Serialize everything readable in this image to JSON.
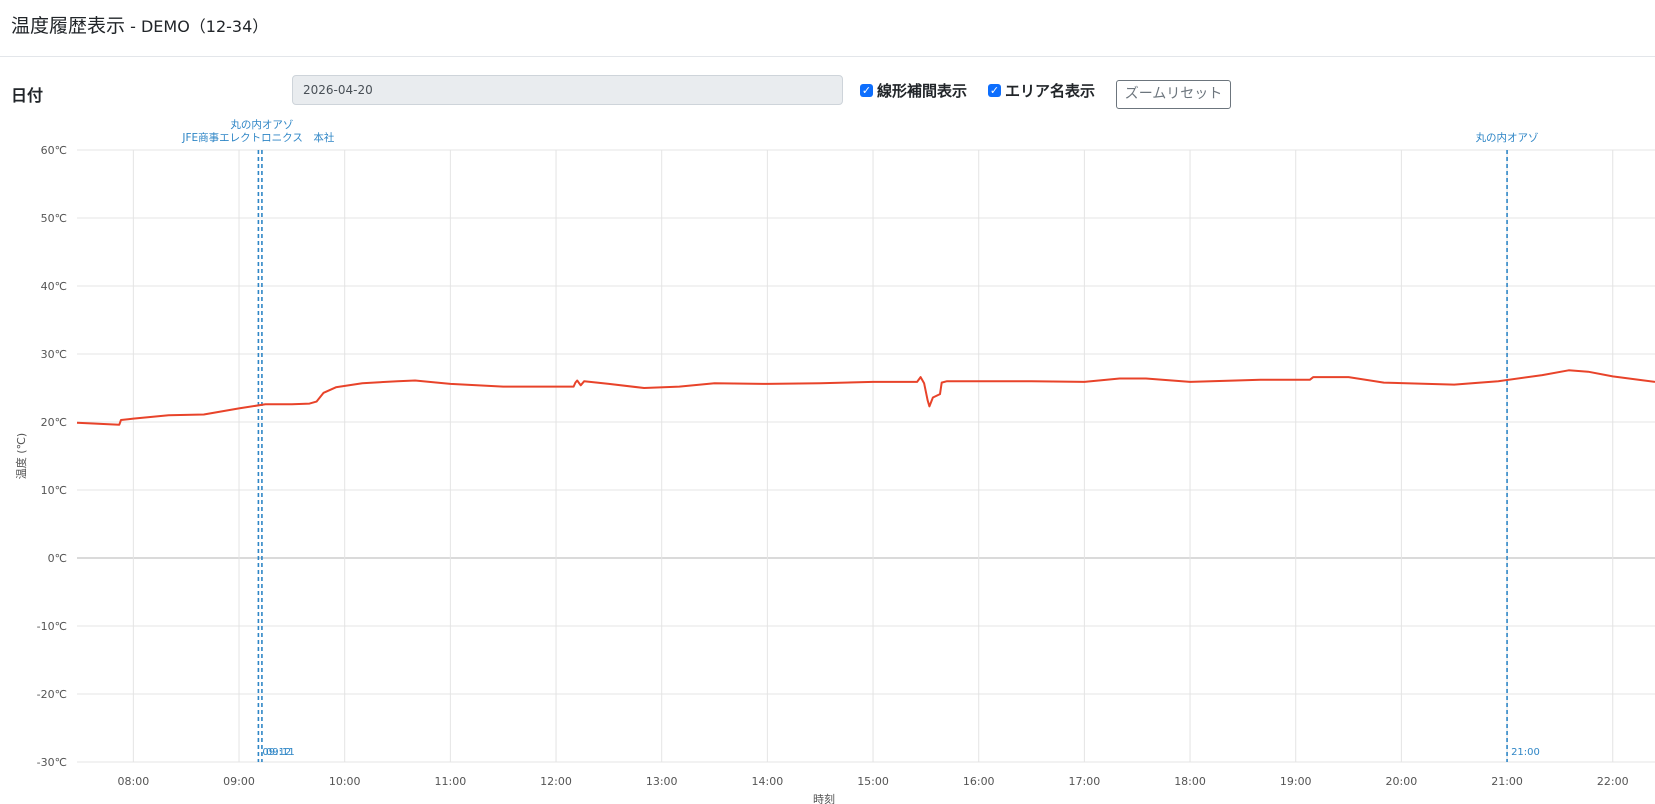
{
  "header": {
    "title_main": "温度履歴表示",
    "title_sub": " - DEMO（12-34）"
  },
  "toolbar": {
    "date_label": "日付",
    "date_value": "2026-04-20",
    "linear_label": "線形補間表示",
    "linear_checked": true,
    "area_label": "エリア名表示",
    "area_checked": true,
    "reset_label": "ズームリセット",
    "check_glyph": "✓"
  },
  "colors": {
    "series": "#e8432a",
    "event": "#2f86c6",
    "checkbox": "#0d6efd"
  },
  "chart_data": {
    "type": "line",
    "title": "",
    "xlabel": "時刻",
    "ylabel": "温度 (℃)",
    "xlim": [
      "07:28",
      "22:24"
    ],
    "ylim": [
      -30,
      60
    ],
    "y_ticks": [
      -30,
      -20,
      -10,
      0,
      10,
      20,
      30,
      40,
      50,
      60
    ],
    "y_tick_labels": [
      "-30℃",
      "-20℃",
      "-10℃",
      "0℃",
      "10℃",
      "20℃",
      "30℃",
      "40℃",
      "50℃",
      "60℃"
    ],
    "x_ticks": [
      "08:00",
      "09:00",
      "10:00",
      "11:00",
      "12:00",
      "13:00",
      "14:00",
      "15:00",
      "16:00",
      "17:00",
      "18:00",
      "19:00",
      "20:00",
      "21:00",
      "22:00"
    ],
    "grid": true,
    "series": [
      {
        "values": [
          [
            "07:28",
            19.9
          ],
          [
            "07:52",
            19.6
          ],
          [
            "07:53",
            20.3
          ],
          [
            "08:00",
            20.5
          ],
          [
            "08:20",
            21.0
          ],
          [
            "08:40",
            21.1
          ],
          [
            "09:00",
            22.0
          ],
          [
            "09:15",
            22.6
          ],
          [
            "09:30",
            22.6
          ],
          [
            "09:40",
            22.7
          ],
          [
            "09:44",
            23.0
          ],
          [
            "09:48",
            24.3
          ],
          [
            "09:55",
            25.1
          ],
          [
            "10:10",
            25.7
          ],
          [
            "10:30",
            26.0
          ],
          [
            "10:40",
            26.1
          ],
          [
            "11:00",
            25.6
          ],
          [
            "11:30",
            25.2
          ],
          [
            "12:10",
            25.2
          ],
          [
            "12:11",
            25.8
          ],
          [
            "12:12",
            26.1
          ],
          [
            "12:14",
            25.4
          ],
          [
            "12:16",
            26.0
          ],
          [
            "12:30",
            25.6
          ],
          [
            "12:50",
            25.0
          ],
          [
            "13:10",
            25.2
          ],
          [
            "13:30",
            25.7
          ],
          [
            "14:00",
            25.6
          ],
          [
            "14:30",
            25.7
          ],
          [
            "15:00",
            25.9
          ],
          [
            "15:25",
            25.9
          ],
          [
            "15:27",
            26.6
          ],
          [
            "15:29",
            25.7
          ],
          [
            "15:31",
            23.2
          ],
          [
            "15:32",
            22.3
          ],
          [
            "15:34",
            23.6
          ],
          [
            "15:38",
            24.1
          ],
          [
            "15:39",
            25.8
          ],
          [
            "15:42",
            26.0
          ],
          [
            "16:00",
            26.0
          ],
          [
            "16:30",
            26.0
          ],
          [
            "17:00",
            25.9
          ],
          [
            "17:20",
            26.4
          ],
          [
            "17:35",
            26.4
          ],
          [
            "18:00",
            25.9
          ],
          [
            "18:40",
            26.2
          ],
          [
            "19:08",
            26.2
          ],
          [
            "19:10",
            26.6
          ],
          [
            "19:30",
            26.6
          ],
          [
            "19:50",
            25.8
          ],
          [
            "20:30",
            25.5
          ],
          [
            "20:55",
            26.0
          ],
          [
            "21:20",
            26.9
          ],
          [
            "21:35",
            27.6
          ],
          [
            "21:46",
            27.4
          ],
          [
            "22:00",
            26.7
          ],
          [
            "22:24",
            25.9
          ]
        ]
      }
    ],
    "events": [
      {
        "x": "09:11",
        "label": "09:12",
        "area": "JFE商事エレクトロニクス　本社"
      },
      {
        "x": "09:13",
        "label": "09:11",
        "area": "丸の内オアゾ"
      },
      {
        "x": "21:00",
        "label": "21:00",
        "area": "丸の内オアゾ"
      }
    ]
  }
}
